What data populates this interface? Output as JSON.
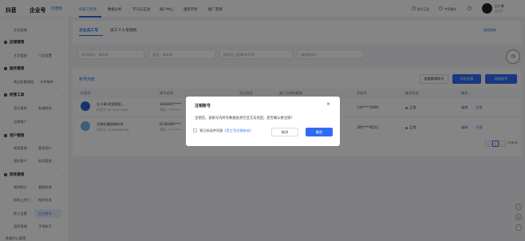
{
  "app": {
    "logo_text": "抖音",
    "product_name": "企业号",
    "old_version_link": "回老版"
  },
  "topnav": [
    {
      "label": "抖音工作台",
      "active": true
    },
    {
      "label": "数据分析",
      "active": false
    },
    {
      "label": "学习与互动",
      "active": false
    },
    {
      "label": "账户中心",
      "active": false
    },
    {
      "label": "服务市场",
      "active": false
    },
    {
      "label": "推广营销",
      "active": false
    }
  ],
  "topright": {
    "item1": "账号互动",
    "item2": "专项服务",
    "item3": "企业号"
  },
  "user": {
    "name": "企小课",
    "sub": "企业号"
  },
  "sidebar": {
    "top_item": "开启管理",
    "sections": [
      {
        "title": "店铺管理",
        "items": [
          "主页管理",
          "门店设置"
        ]
      },
      {
        "title": "服务管理",
        "items": [
          "商品轮推理案",
          "文件推单"
        ]
      },
      {
        "title": "经营工具",
        "items": [
          "官方表单",
          "私域转化",
          "品牌推广"
        ]
      },
      {
        "title": "用户管理",
        "items": [
          "线索管理",
          "客资用户",
          "潜在客户",
          "标签管理"
        ]
      },
      {
        "title": "矩阵营销",
        "items": [
          "矩阵统计",
          "客服坐席",
          "授权上传门",
          "矩阵任务",
          "职工设置",
          "员工账号",
          "组织管理",
          "子母账号"
        ]
      }
    ],
    "bottom_item": "数据中心管理"
  },
  "tabs": [
    "企业员工号",
    "员工个人号授权"
  ],
  "help_link": "使用指南",
  "filters": {
    "status": "账号状态：请选择",
    "type": "类型：请选择",
    "search": "搜索员工昵称/抖音号",
    "dept": "请选择部门"
  },
  "list": {
    "title": "账号列表",
    "buttons": {
      "batch": "批量解绑账号",
      "export": "导出列表",
      "add": "添加账号"
    },
    "columns": [
      "抖音号",
      "账号名称",
      "员工姓名",
      "部门与岗位职务",
      "手机号",
      "账号状态",
      "操作"
    ],
    "rows": [
      {
        "name": "企小课-经营群组...",
        "id": "抖音号: 61790213081",
        "account": "3440407****",
        "pwd": "密码：********",
        "phone": "130****3268",
        "status": "正常",
        "op1": "编辑",
        "op2": "注销"
      },
      {
        "name": "河南北晨网络科技",
        "id": "抖音号: 98082948036",
        "account": "6136460****",
        "pwd": "密码：********",
        "phone": "185****6222",
        "status": "正常",
        "op1": "编辑",
        "op2": "注销"
      }
    ],
    "pagination": {
      "current": "1",
      "page_size": "10条/页"
    }
  },
  "modal": {
    "title": "注销账号",
    "body": "注销后，该账号内所有数据会清空且无法找回，是否确认要注销？",
    "agree_prefix": "我已阅读并同意",
    "agree_link": "《员工号注销协议》",
    "cancel": "取消",
    "confirm": "确定"
  },
  "colors": {
    "accent": "#2f6cf6",
    "success": "#2fbf71"
  }
}
